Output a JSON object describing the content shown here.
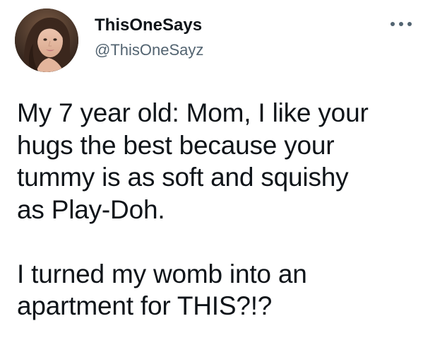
{
  "tweet": {
    "author": {
      "display_name": "ThisOneSays",
      "handle": "@ThisOneSayz",
      "avatar_icon": "profile-photo"
    },
    "more_icon": "more-horizontal-icon",
    "text_lines": [
      "My 7 year old: Mom, I like your",
      "hugs the best because your",
      "tummy is as soft and squishy",
      "as Play-Doh.",
      "",
      "I turned my womb into an",
      "apartment for THIS?!?"
    ]
  },
  "colors": {
    "text": "#0f1419",
    "secondary_text": "#536471",
    "background": "#ffffff"
  }
}
